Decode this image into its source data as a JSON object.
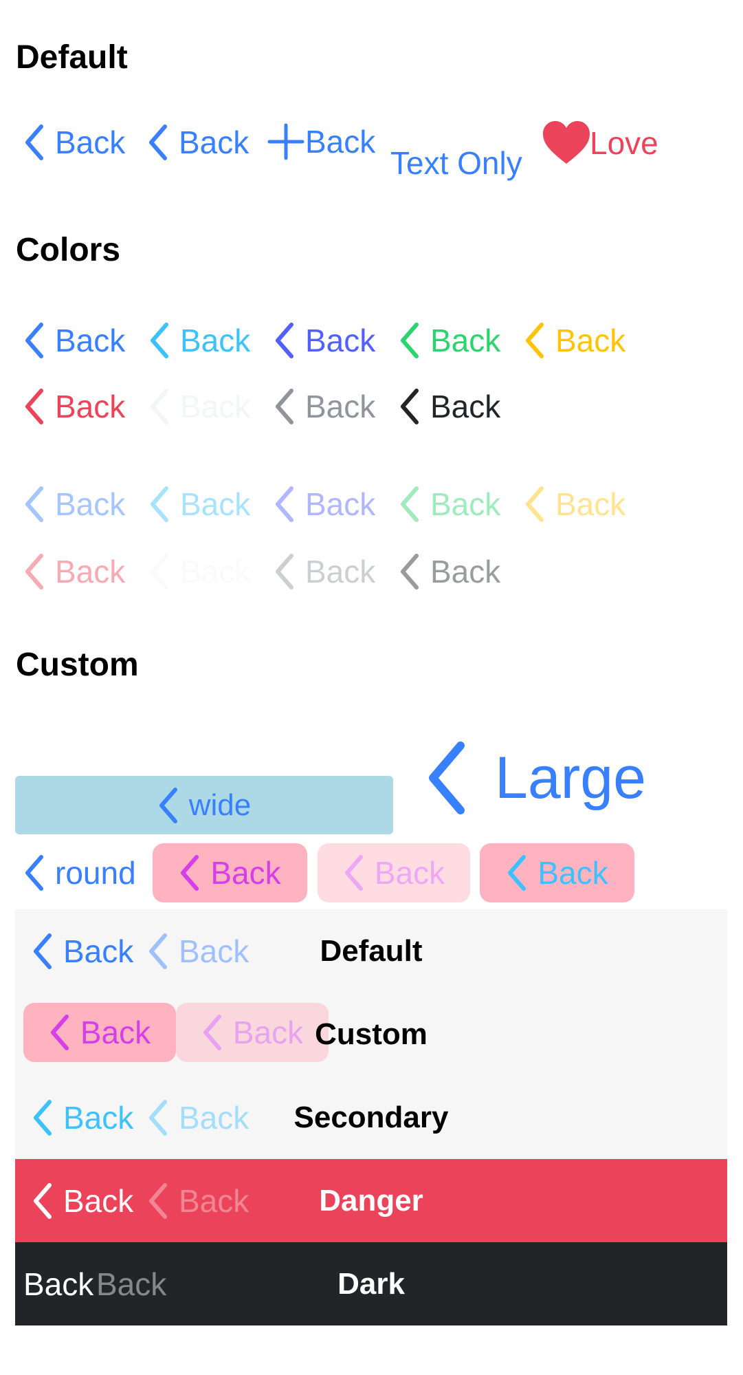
{
  "colors": {
    "primary": "#3880ff",
    "secondary": "#3dc2ff",
    "tertiary": "#5260ff",
    "success": "#2dd36f",
    "warning": "#ffc409",
    "danger": "#eb445a",
    "light": "#f4f5f8",
    "medium": "#92949c",
    "dark": "#222428",
    "custom_bg": "#ffb3c1",
    "custom_text": "#d63fe8",
    "wide_bg": "#add8e6",
    "toolbar_default": "#f6f6f6"
  },
  "sections": {
    "default": "Default",
    "colors": "Colors",
    "custom": "Custom"
  },
  "default_buttons": {
    "back": "Back",
    "text_only": "Text Only",
    "love": "Love",
    "icons": [
      "chevron-back-icon",
      "chevron-back-icon",
      "add-icon",
      "heart-icon"
    ]
  },
  "color_buttons": {
    "label": "Back",
    "row_colors": [
      "primary",
      "secondary",
      "tertiary",
      "success",
      "warning",
      "danger",
      "light",
      "medium",
      "dark"
    ]
  },
  "custom_buttons": {
    "wide": "wide",
    "large": "Large",
    "round": "round",
    "back": "Back"
  },
  "toolbars": [
    {
      "title": "Default",
      "back": "Back",
      "back_disabled": "Back"
    },
    {
      "title": "Custom",
      "back": "Back",
      "back_disabled": "Back"
    },
    {
      "title": "Secondary",
      "back": "Back",
      "back_disabled": "Back"
    },
    {
      "title": "Danger",
      "back": "Back",
      "back_disabled": "Back"
    },
    {
      "title": "Dark",
      "back": "Back",
      "back_disabled": "Back"
    }
  ]
}
